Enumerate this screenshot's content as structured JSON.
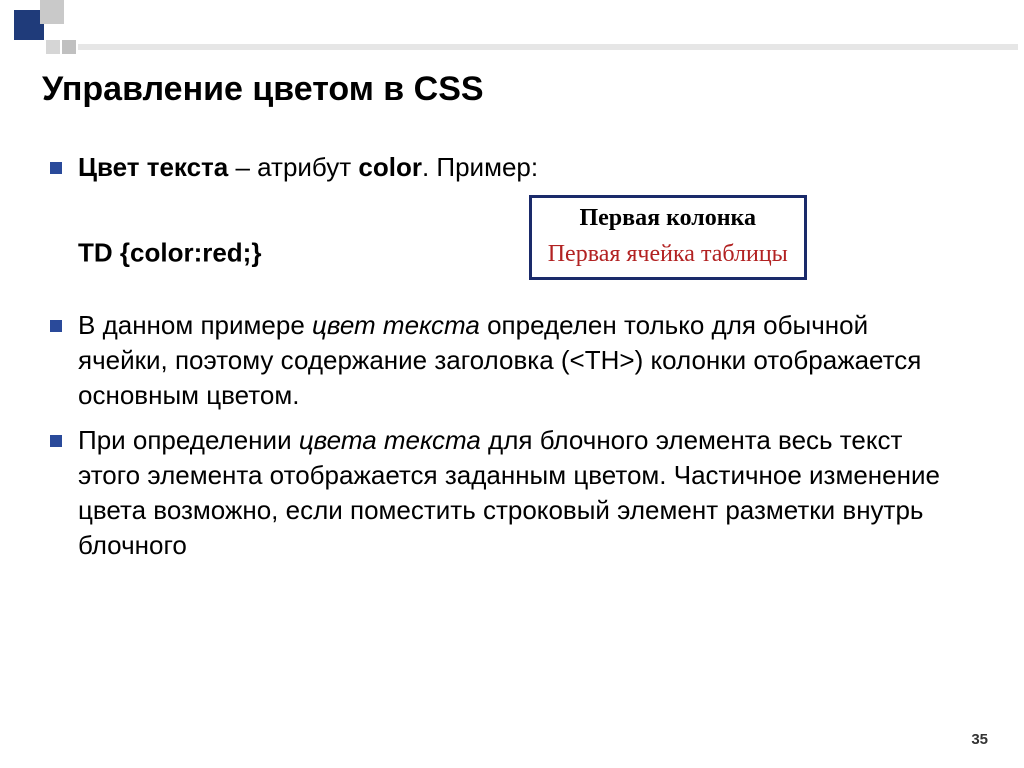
{
  "title": "Управление цветом в CSS",
  "bullets": {
    "b1_bold": "Цвет текста",
    "b1_mid": " – атрибут ",
    "b1_attr": "color",
    "b1_tail": ". Пример:",
    "b1_line2": "TD {color:red;}",
    "b2_pre": "В данном примере ",
    "b2_em": "цвет текста",
    "b2_post": " определен только для обычной ячейки, поэтому содержание заголовка (<TH>) колонки отображается основным цветом.",
    "b3_pre": "При определении ",
    "b3_em": "цвета текста",
    "b3_post": " для блочного элемента весь текст этого элемента отображается заданным цветом. Частичное изменение цвета возможно, если поместить строковый элемент разметки внутрь блочного"
  },
  "table_demo": {
    "th": "Первая колонка",
    "td": "Первая ячейка таблицы"
  },
  "page_number": "35"
}
